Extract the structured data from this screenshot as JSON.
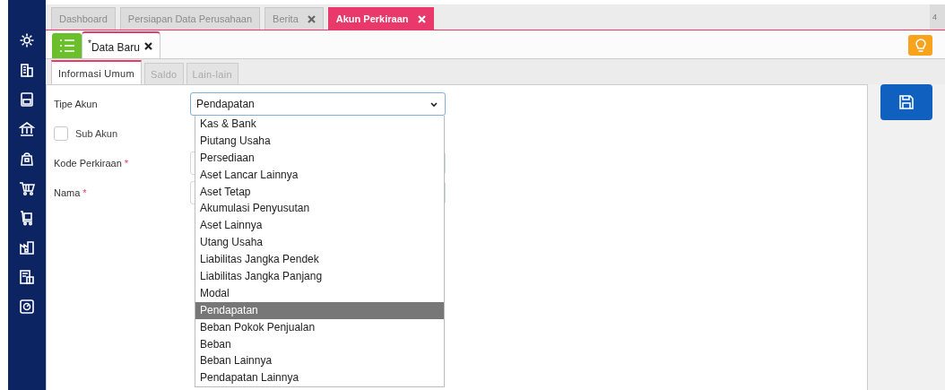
{
  "top_tabs": [
    {
      "label": "Dashboard",
      "closable": false,
      "selected": false
    },
    {
      "label": "Persiapan Data Perusahaan",
      "closable": false,
      "selected": false
    },
    {
      "label": "Berita",
      "closable": true,
      "selected": false
    },
    {
      "label": "Akun Perkiraan",
      "closable": true,
      "selected": true
    }
  ],
  "tab_overflow": "4",
  "document_tabs": [
    {
      "label": "$^{*}$Data Baru",
      "closable": true,
      "selected": true
    }
  ],
  "form_tabs": [
    {
      "label": "Informasi Umum",
      "selected": true
    },
    {
      "label": "Saldo",
      "selected": false
    },
    {
      "label": "Lain-lain",
      "selected": false
    }
  ],
  "fields": [
    {
      "kind": "select",
      "label": "Tipe Akun",
      "value": "Pendapatan"
    },
    {
      "kind": "checkbox",
      "label": "Sub Akun",
      "checked": false
    },
    {
      "kind": "text",
      "label": "Kode Perkiraan",
      "required_mark": "*"
    },
    {
      "kind": "text",
      "label": "Nama",
      "required_mark": "*"
    }
  ],
  "dropdown": {
    "options": [
      {
        "label": "Kas & Bank",
        "selected": false
      },
      {
        "label": "Piutang Usaha",
        "selected": false
      },
      {
        "label": "Persediaan",
        "selected": false
      },
      {
        "label": "Aset Lancar Lainnya",
        "selected": false
      },
      {
        "label": "Aset Tetap",
        "selected": false
      },
      {
        "label": "Akumulasi Penyusutan",
        "selected": false
      },
      {
        "label": "Aset Lainnya",
        "selected": false
      },
      {
        "label": "Utang Usaha",
        "selected": false
      },
      {
        "label": "Liabilitas Jangka Pendek",
        "selected": false
      },
      {
        "label": "Liabilitas Jangka Panjang",
        "selected": false
      },
      {
        "label": "Modal",
        "selected": false
      },
      {
        "label": "Pendapatan",
        "selected": true
      },
      {
        "label": "Beban Pokok Penjualan",
        "selected": false
      },
      {
        "label": "Beban",
        "selected": false
      },
      {
        "label": "Beban Lainnya",
        "selected": false
      },
      {
        "label": "Pendapatan Lainnya",
        "selected": false
      }
    ]
  }
}
